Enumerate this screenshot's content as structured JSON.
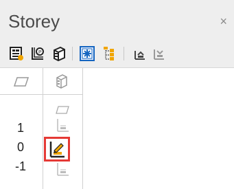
{
  "panel": {
    "title": "Storey",
    "close_glyph": "×"
  },
  "toolbar": {
    "buttons": [
      {
        "name": "storey-settings-icon"
      },
      {
        "name": "storey-properties-icon"
      },
      {
        "name": "storey-3d-view-icon"
      },
      {
        "name": "storey-select-all-icon"
      },
      {
        "name": "storey-tree-icon"
      },
      {
        "name": "storey-move-up-icon"
      },
      {
        "name": "storey-move-down-icon"
      }
    ]
  },
  "levels": [
    "1",
    "0",
    "-1"
  ],
  "colors": {
    "selection_outline": "#e53935",
    "accent_icon": "#f0a500",
    "blue_button": "#1565c0"
  }
}
